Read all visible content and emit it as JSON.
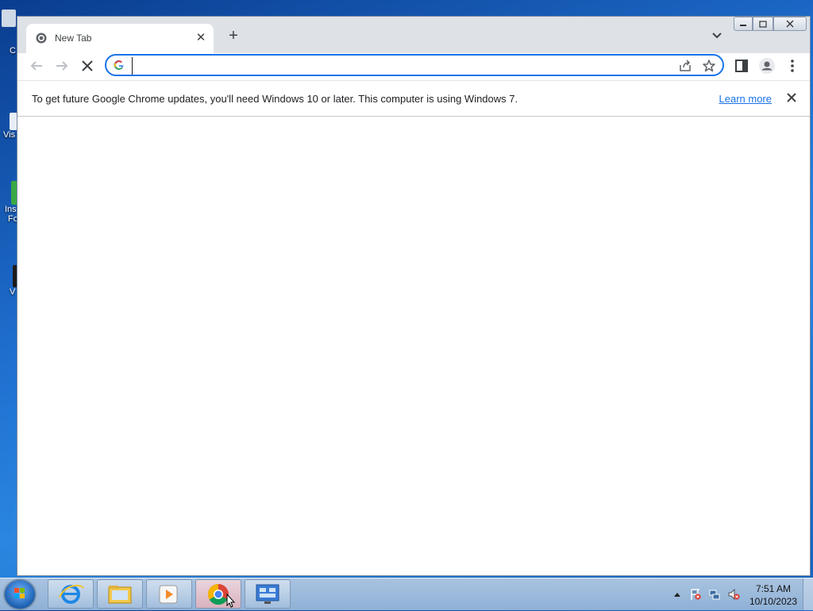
{
  "window": {
    "tab": {
      "title": "New Tab"
    },
    "omnibox": {
      "value": "",
      "placeholder": ""
    }
  },
  "infobar": {
    "message": "To get future Google Chrome updates, you'll need Windows 10 or later. This computer is using Windows 7.",
    "link_label": "Learn more"
  },
  "desktop": {
    "icons": [
      {
        "label": "C",
        "icon": "recycle-bin-icon"
      },
      {
        "label": "Vis",
        "icon": "app-shortcut-icon"
      },
      {
        "label": "Ins",
        "label2": "Fo",
        "icon": "installer-icon"
      },
      {
        "label": "V",
        "icon": "app-shortcut-icon"
      }
    ]
  },
  "taskbar": {
    "items": [
      "internet-explorer-icon",
      "file-explorer-icon",
      "media-player-icon",
      "chrome-icon",
      "control-panel-icon"
    ],
    "clock": {
      "time": "7:51 AM",
      "date": "10/10/2023"
    }
  },
  "colors": {
    "accent": "#1a73e8",
    "titlebar": "#dee1e6",
    "taskbar": "#9cbadb"
  }
}
